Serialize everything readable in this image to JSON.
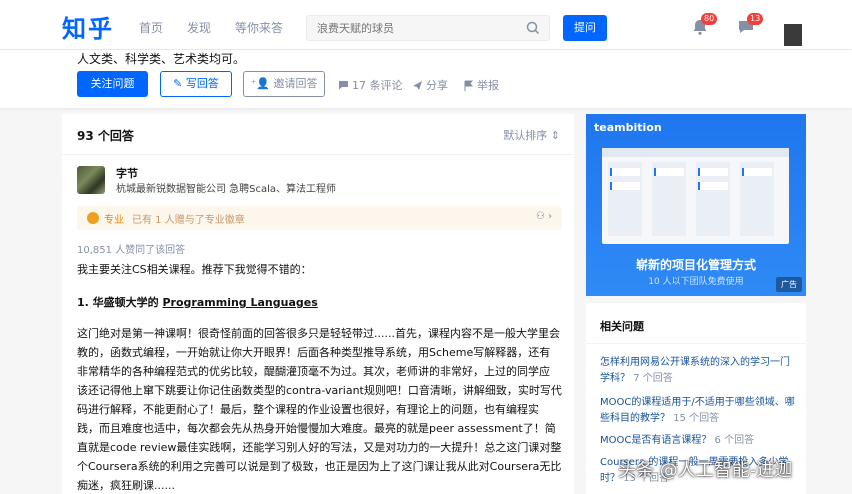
{
  "header": {
    "logo": "知乎",
    "nav": [
      "首页",
      "发现",
      "等你来答"
    ],
    "search_placeholder": "浪费天赋的球员",
    "ask_button": "提问",
    "notifications_count": "80",
    "messages_count": "13"
  },
  "question": {
    "topic_line": "人文类、科学类、艺术类均可。",
    "follow_button": "关注问题",
    "write_button": "写回答",
    "invite_button": "邀请回答",
    "comments": "17 条评论",
    "share": "分享",
    "report": "举报"
  },
  "answers": {
    "count": "93 个回答",
    "sort": "默认排序",
    "author_name": "字节",
    "author_desc": "杭城最新锐数据智能公司 急聘Scala、算法工程师",
    "badge_label": "专业",
    "badge_text": "已有 1 人赠与了专业徽章",
    "votes": "10,851 人赞同了该回答",
    "intro": "我主要关注CS相关课程。推荐下我觉得不错的：",
    "heading_prefix": "1. 华盛顿大学的 ",
    "heading_link": "Programming Languages",
    "paragraph": [
      "这门绝对是第一神课啊！很奇怪前面的回答很多只是轻轻带过......首先，课程内容不是一般大学里会",
      "教的，函数式编程，一开始就让你大开眼界！后面各种类型推导系统，用Scheme写解释器，还有",
      "非常精华的各种编程范式的优劣比较，醍醐灌顶毫不为过。其次，老师讲的非常好，上过的同学应",
      "该还记得他上窜下跳要让你记住函数类型的contra-variant规则吧！口音清晰，讲解细致，实时写代",
      "码进行解释，不能更耐心了！最后，整个课程的作业设置也很好，有理论上的问题，也有编程实",
      "践，而且难度也适中，每次都会先从热身开始慢慢加大难度。最亮的就是peer assessment了！简",
      "直就是code review最佳实践啊，还能学习别人好的写法，又是对功力的一大提升！总之这门课对整",
      "个Coursera系统的利用之完善可以说是到了极致，也正是因为上了这门课让我从此对Coursera无比",
      "痴迷，疯狂刷课......"
    ]
  },
  "sidebar": {
    "ad_brand": "teambition",
    "ad_slogan": "崭新的项目化管理方式",
    "ad_sub": "10 人以下团队免费使用",
    "ad_tag": "广告",
    "related_title": "相关问题",
    "related": [
      {
        "q": "怎样利用网易公开课系统的深入的学习一门学科？",
        "n": "7 个回答"
      },
      {
        "q": "MOOC的课程适用于/不适用于哪些领域、哪些科目的教学？",
        "n": "15 个回答"
      },
      {
        "q": "MOOC是否有语言课程？",
        "n": "6 个回答"
      },
      {
        "q": "Coursera 的课程一般一周需要投入多少学时？",
        "n": "13 个回答"
      }
    ]
  },
  "watermark": "头条 @人工智能-进迦",
  "colors": {
    "brand": "#0066ff",
    "muted": "#8590a6",
    "badge": "#f1403c"
  }
}
